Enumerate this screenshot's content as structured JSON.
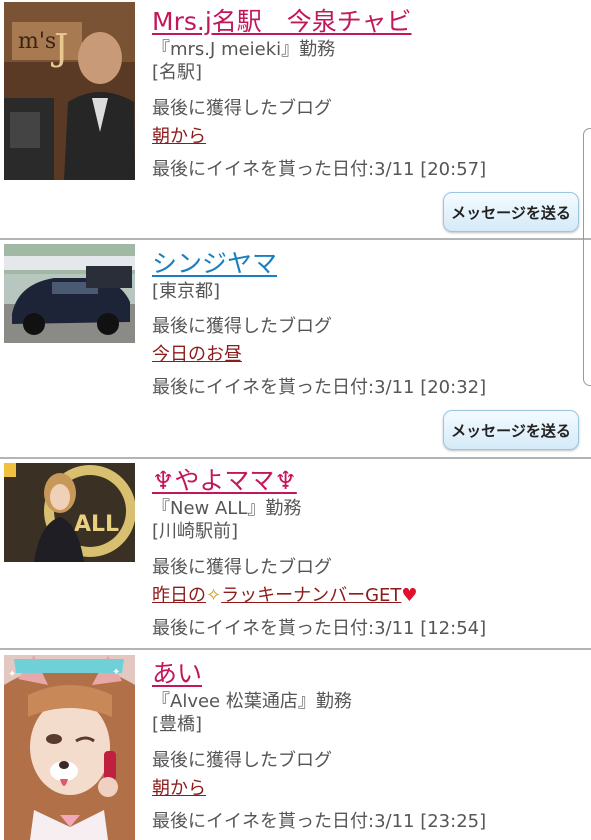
{
  "entries": [
    {
      "name": "Mrs.j名駅　今泉チャビ",
      "name_color": "#c2185b",
      "shop": "『mrs.J meieki』勤務",
      "area": "[名駅]",
      "blog_label": "最後に獲得したブログ",
      "blog_title": "朝から",
      "like_date": "最後にイイネを貰った日付:3/11 [20:57]",
      "message_button": "メッセージを送る"
    },
    {
      "name": "シンジヤマ",
      "name_color": "#1a7fbf",
      "shop": "",
      "area": "[東京都]",
      "blog_label": "最後に獲得したブログ",
      "blog_title": "今日のお昼",
      "like_date": "最後にイイネを貰った日付:3/11 [20:32]",
      "message_button": "メッセージを送る"
    },
    {
      "name": "♆やよママ♆",
      "name_color": "#c2185b",
      "shop": "『New ALL』勤務",
      "area": "[川崎駅前]",
      "blog_label": "最後に獲得したブログ",
      "blog_title_a": "昨日の",
      "blog_title_b": "ラッキーナンバーGET",
      "like_date": "最後にイイネを貰った日付:3/11 [12:54]"
    },
    {
      "name": "あい",
      "name_color": "#c2185b",
      "shop": "『Alvee 松葉通店』勤務",
      "area": "[豊橋]",
      "blog_label": "最後に獲得したブログ",
      "blog_title": "朝から",
      "like_date": "最後にイイネを貰った日付:3/11 [23:25]"
    }
  ],
  "icons": {
    "sparkle": "sparkle-icon",
    "heart": "heart-icon"
  },
  "colors": {
    "blog_link": "#8e1b1b",
    "button_bg": "#d5eaf8",
    "divider": "#b4b4b4"
  }
}
